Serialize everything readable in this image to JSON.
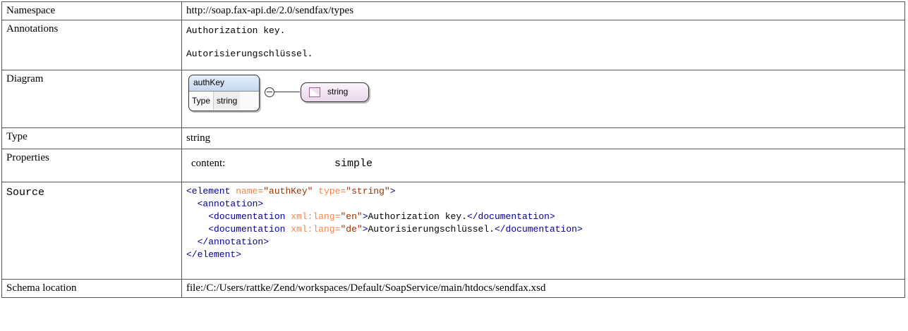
{
  "rows": {
    "namespace": {
      "label": "Namespace",
      "value": "http://soap.fax-api.de/2.0/sendfax/types"
    },
    "annotations": {
      "label": "Annotations",
      "lines": [
        "Authorization key.",
        "Autorisierungschlüssel."
      ]
    },
    "diagram": {
      "label": "Diagram",
      "element_name": "authKey",
      "type_key": "Type",
      "type_value": "string",
      "simple_type": "string",
      "icons": [
        "sequence-icon",
        "simple-type-icon"
      ]
    },
    "type": {
      "label": "Type",
      "value": "string"
    },
    "properties": {
      "label": "Properties",
      "key": "content:",
      "value": "simple"
    },
    "source": {
      "label": "Source",
      "l1_open": "<element",
      "l1_attr1": "name=",
      "l1_val1": "\"authKey\"",
      "l1_attr2": "type=",
      "l1_val2": "\"string\"",
      "l1_close": ">",
      "l2": "<annotation>",
      "l3_open": "<documentation",
      "l3_attr": "xml:lang=",
      "l3_val": "\"en\"",
      "l3_gt": ">",
      "l3_text": "Authorization key.",
      "l3_end": "</documentation>",
      "l4_open": "<documentation",
      "l4_attr": "xml:lang=",
      "l4_val": "\"de\"",
      "l4_gt": ">",
      "l4_text": "Autorisierungschlüssel.",
      "l4_end": "</documentation>",
      "l5": "</annotation>",
      "l6": "</element>"
    },
    "schema_location": {
      "label": "Schema location",
      "value": "file:/C:/Users/rattke/Zend/workspaces/Default/SoapService/main/htdocs/sendfax.xsd"
    }
  },
  "colors": {
    "tag": "#000096",
    "attr": "#F5844C",
    "string": "#993300",
    "border": "#555555"
  }
}
